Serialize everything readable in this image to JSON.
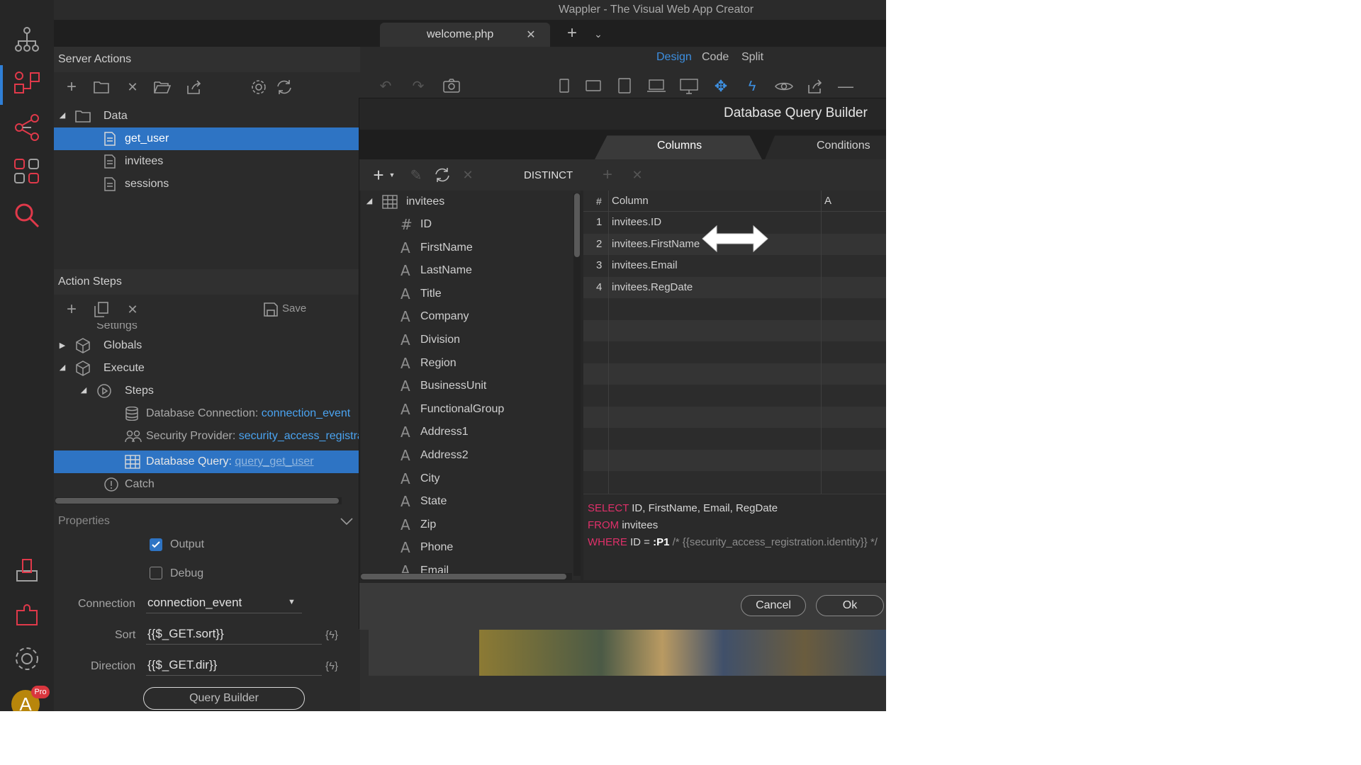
{
  "window": {
    "title": "Wappler - The Visual Web App Creator"
  },
  "tabs": [
    {
      "label": "welcome.php"
    }
  ],
  "modes": {
    "design": "Design",
    "code": "Code",
    "split": "Split"
  },
  "server_actions": {
    "title": "Server Actions",
    "tree": {
      "folder": "Data",
      "items": [
        "get_user",
        "invitees",
        "sessions"
      ]
    }
  },
  "action_steps": {
    "title": "Action Steps",
    "save_label": "Save",
    "settings_label": "Settings",
    "globals": "Globals",
    "execute": "Execute",
    "steps": "Steps",
    "db_connection": {
      "label": "Database Connection: ",
      "value": "connection_event"
    },
    "security_provider": {
      "label": "Security Provider: ",
      "value": "security_access_registra"
    },
    "db_query": {
      "label": "Database Query: ",
      "value": "query_get_user"
    },
    "catch": "Catch"
  },
  "properties": {
    "title": "Properties",
    "output_label": "Output",
    "debug_label": "Debug",
    "connection": {
      "label": "Connection",
      "value": "connection_event"
    },
    "sort": {
      "label": "Sort",
      "value": "{{$_GET.sort}}"
    },
    "direction": {
      "label": "Direction",
      "value": "{{$_GET.dir}}"
    },
    "query_builder_button": "Query Builder"
  },
  "dialog": {
    "title": "Database Query Builder",
    "tabs": {
      "columns": "Columns",
      "conditions": "Conditions"
    },
    "distinct_label": "DISTINCT",
    "table_name": "invitees",
    "fields": [
      {
        "type": "#",
        "name": "ID"
      },
      {
        "type": "A",
        "name": "FirstName"
      },
      {
        "type": "A",
        "name": "LastName"
      },
      {
        "type": "A",
        "name": "Title"
      },
      {
        "type": "A",
        "name": "Company"
      },
      {
        "type": "A",
        "name": "Division"
      },
      {
        "type": "A",
        "name": "Region"
      },
      {
        "type": "A",
        "name": "BusinessUnit"
      },
      {
        "type": "A",
        "name": "FunctionalGroup"
      },
      {
        "type": "A",
        "name": "Address1"
      },
      {
        "type": "A",
        "name": "Address2"
      },
      {
        "type": "A",
        "name": "City"
      },
      {
        "type": "A",
        "name": "State"
      },
      {
        "type": "A",
        "name": "Zip"
      },
      {
        "type": "A",
        "name": "Phone"
      },
      {
        "type": "A",
        "name": "Email"
      }
    ],
    "grid": {
      "headers": {
        "num": "#",
        "column": "Column",
        "alias": "A"
      },
      "rows": [
        {
          "num": "1",
          "column": "invitees.ID"
        },
        {
          "num": "2",
          "column": "invitees.FirstName"
        },
        {
          "num": "3",
          "column": "invitees.Email"
        },
        {
          "num": "4",
          "column": "invitees.RegDate"
        }
      ]
    },
    "sql": {
      "select_kw": "SELECT",
      "select_cols": " ID, FirstName, Email, RegDate",
      "from_kw": "FROM",
      "from_table": " invitees",
      "where_kw": "WHERE",
      "where_cond": " ID = ",
      "where_param": ":P1",
      "where_comment": " /* {{security_access_registration.identity}} */"
    },
    "buttons": {
      "cancel": "Cancel",
      "ok": "Ok"
    }
  },
  "user": {
    "avatar_letter": "A",
    "badge": "Pro"
  },
  "colors": {
    "accent": "#2e74c4",
    "sql_keyword": "#e0306a",
    "link": "#4aa3f0"
  }
}
